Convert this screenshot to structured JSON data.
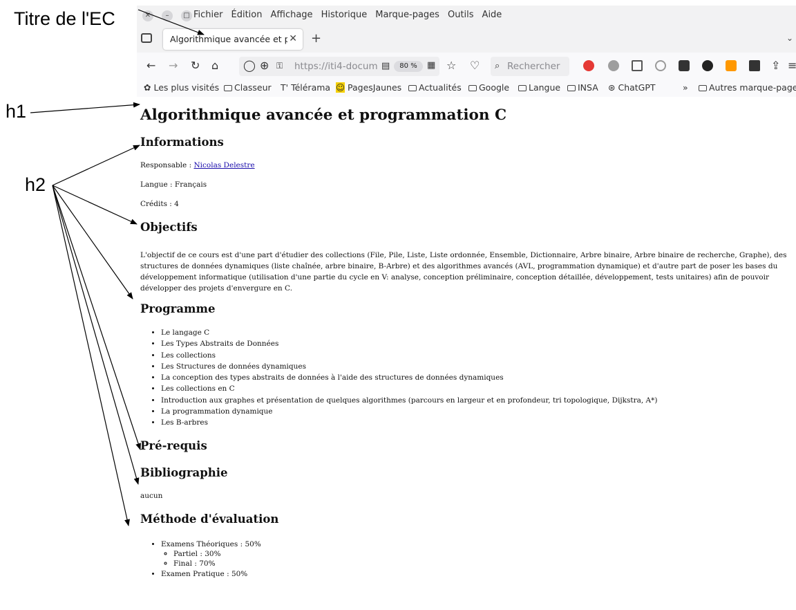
{
  "annotations": {
    "ec_title": "Titre de l'EC",
    "h1": "h1",
    "h2": "h2"
  },
  "menubar": {
    "items": [
      "Fichier",
      "Édition",
      "Affichage",
      "Historique",
      "Marque-pages",
      "Outils",
      "Aide"
    ]
  },
  "window_buttons": {
    "close": "✕",
    "minimize": "–",
    "maximize": "□"
  },
  "tab": {
    "title": "Algorithmique avancée et pr",
    "close": "✕",
    "new_tab": "+"
  },
  "toolbar": {
    "url": "https://iti4-docum",
    "zoom": "80 %",
    "search_placeholder": "Rechercher"
  },
  "bookmarks": {
    "items": [
      "Les plus visités",
      "Classeur",
      "Télérama",
      "PagesJaunes",
      "Actualités",
      "Google",
      "Langue",
      "INSA",
      "ChatGPT"
    ],
    "overflow": "»",
    "other": "Autres marque-page"
  },
  "page": {
    "title": "Algorithmique avancée et programmation C",
    "informations_heading": "Informations",
    "responsable_label": "Responsable : ",
    "responsable_name": "Nicolas Delestre",
    "langue": "Langue : Français",
    "credits": "Crédits : 4",
    "objectifs_heading": "Objectifs",
    "objectifs_text": "L'objectif de ce cours est d'une part d'étudier des collections (File, Pile, Liste, Liste ordonnée, Ensemble, Dictionnaire, Arbre binaire, Arbre binaire de recherche, Graphe), des structures de données dynamiques (liste chaînée, arbre binaire, B-Arbre) et des algorithmes avancés (AVL, programmation dynamique) et d'autre part de poser les bases du développement informatique (utilisation d'une partie du cycle en V: analyse, conception préliminaire, conception détaillée, développement, tests unitaires) afin de pouvoir développer des projets d'envergure en C.",
    "programme_heading": "Programme",
    "programme_items": [
      "Le langage C",
      "Les Types Abstraits de Données",
      "Les collections",
      "Les Structures de données dynamiques",
      "La conception des types abstraits de données à l'aide des structures de données dynamiques",
      "Les collections en C",
      "Introduction aux graphes et présentation de quelques algorithmes (parcours en largeur et en profondeur, tri topologique, Dijkstra, A*)",
      "La programmation dynamique",
      "Les B-arbres"
    ],
    "prerequis_heading": "Pré-requis",
    "bibliographie_heading": "Bibliographie",
    "bibliographie_text": "aucun",
    "evaluation_heading": "Méthode d'évaluation",
    "evaluation": {
      "theorique": "Examens Théoriques : 50%",
      "partiel": "Partiel : 30%",
      "final": "Final : 70%",
      "pratique": "Examen Pratique : 50%"
    }
  }
}
